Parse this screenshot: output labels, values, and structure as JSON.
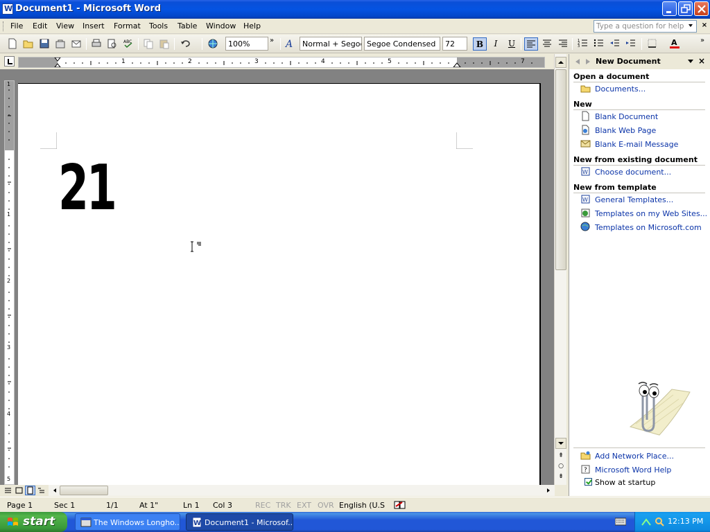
{
  "window": {
    "title": "Document1 - Microsoft Word"
  },
  "menu": {
    "items": [
      "File",
      "Edit",
      "View",
      "Insert",
      "Format",
      "Tools",
      "Table",
      "Window",
      "Help"
    ],
    "help_placeholder": "Type a question for help"
  },
  "toolbar": {
    "zoom": "100%",
    "style": "Normal + Segoe",
    "font": "Segoe Condensed",
    "size": "72",
    "bold_label": "B",
    "italic_label": "I",
    "underline_label": "U"
  },
  "ruler": {
    "numbers": [
      "1",
      "2",
      "3",
      "4",
      "5",
      "7"
    ]
  },
  "vruler": {
    "numbers": [
      "1",
      "1",
      "2",
      "3",
      "4",
      "5"
    ]
  },
  "document": {
    "text": "21"
  },
  "taskpane": {
    "title": "New Document",
    "sections": {
      "open": "Open a document",
      "new": "New",
      "existing": "New from existing document",
      "template": "New from template"
    },
    "links": {
      "documents": "Documents...",
      "blank_doc": "Blank Document",
      "blank_web": "Blank Web Page",
      "blank_email": "Blank E-mail Message",
      "choose_doc": "Choose document...",
      "general_templates": "General Templates...",
      "web_templates": "Templates on my Web Sites...",
      "ms_templates": "Templates on Microsoft.com",
      "network_place": "Add Network Place...",
      "word_help": "Microsoft Word Help"
    },
    "show_at_startup": "Show at startup",
    "show_at_startup_checked": true
  },
  "statusbar": {
    "page": "Page  1",
    "sec": "Sec  1",
    "pages": "1/1",
    "at": "At  1\"",
    "ln": "Ln  1",
    "col": "Col  3",
    "rec": "REC",
    "trk": "TRK",
    "ext": "EXT",
    "ovr": "OVR",
    "language": "English (U.S"
  },
  "taskbar": {
    "start": "start",
    "buttons": [
      "The Windows Longho...",
      "Document1 - Microsof..."
    ],
    "clock": "12:13 PM"
  }
}
